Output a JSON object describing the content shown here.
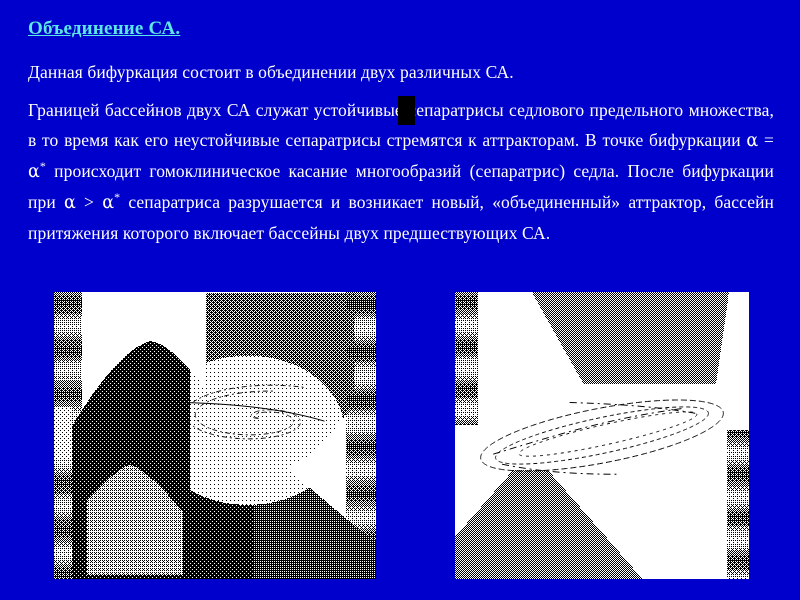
{
  "slide": {
    "background_color": "#0000cc",
    "title": "Объединение СА.",
    "title_color": "#5ce6e6",
    "body_color": "#ffffff",
    "intro_paragraph": "Данная бифуркация состоит в объединении двух различных СА.",
    "body_paragraph_parts": {
      "p1": "Границей бассейнов двух СА служат устойчивые сепаратрисы седлового предельного множества, в то время как его неустойчивые сепаратрисы стремятся к аттракторам. В точке бифуркации ",
      "alpha1": "α",
      "eq": " = ",
      "alpha2": "α",
      "star1": "*",
      "p2": " происходит гомоклиническое касание многообразий (сепаратрис) седла. После бифуркации при ",
      "alpha3": "α",
      "gt": " > ",
      "alpha4": "α",
      "star2": "*",
      "p3": " сепаратриса разрушается и возникает новый, «объединенный» аттрактор, бассейн притяжения которого включает бассейны двух предшествующих СА."
    },
    "full_body_text": "Границей бассейнов двух СА служат устойчивые сепаратрисы седлового предельного множества, в то время как его неустойчивые сепаратрисы стремятся к аттракторам. В точке бифуркации α = α* происходит гомоклиническое касание многообразий (сепаратрис) седла. После бифуркации при α > α* сепаратриса разрушается и возникает новый, «объединенный» аттрактор, бассейн притяжения которого включает бассейны двух предшествующих СА."
  },
  "figures": {
    "left": {
      "name": "basin-diagram-before-merge",
      "background_color": "#ffffff",
      "ink_color": "#000000",
      "description": "Dithered black-and-white phase portrait showing two separate basins of attraction with saddle separatrices"
    },
    "right": {
      "name": "basin-diagram-after-merge",
      "background_color": "#ffffff",
      "ink_color": "#000000",
      "description": "Dithered black-and-white phase portrait showing the merged attractor and its unified basin"
    }
  },
  "artifacts": {
    "text_caret": {
      "name": "text-caret",
      "color": "#000000"
    }
  }
}
